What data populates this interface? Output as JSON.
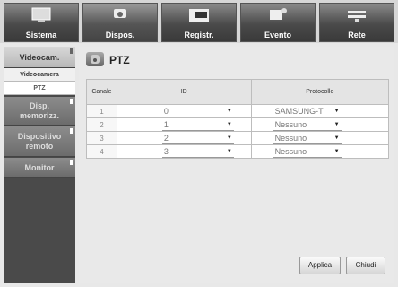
{
  "tabs": [
    {
      "label": "Sistema",
      "icon": "monitor-icon"
    },
    {
      "label": "Dispos.",
      "icon": "camera-icon"
    },
    {
      "label": "Registr.",
      "icon": "record-icon"
    },
    {
      "label": "Evento",
      "icon": "event-icon"
    },
    {
      "label": "Rete",
      "icon": "network-icon"
    }
  ],
  "sidebar": {
    "items": [
      {
        "label": "Videocam."
      },
      {
        "label": "Disp. memorizz."
      },
      {
        "label": "Dispositivo remoto"
      },
      {
        "label": "Monitor"
      }
    ],
    "subitems": [
      {
        "label": "Videocamera"
      },
      {
        "label": "PTZ"
      }
    ]
  },
  "page": {
    "title": "PTZ"
  },
  "table": {
    "headers": {
      "channel": "Canale",
      "id": "ID",
      "protocol": "Protocollo"
    },
    "rows": [
      {
        "channel": "1",
        "id": "0",
        "protocol": "SAMSUNG-T"
      },
      {
        "channel": "2",
        "id": "1",
        "protocol": "Nessuno"
      },
      {
        "channel": "3",
        "id": "2",
        "protocol": "Nessuno"
      },
      {
        "channel": "4",
        "id": "3",
        "protocol": "Nessuno"
      }
    ]
  },
  "buttons": {
    "apply": "Applica",
    "close": "Chiudi"
  },
  "dropdown_arrow": "▼"
}
